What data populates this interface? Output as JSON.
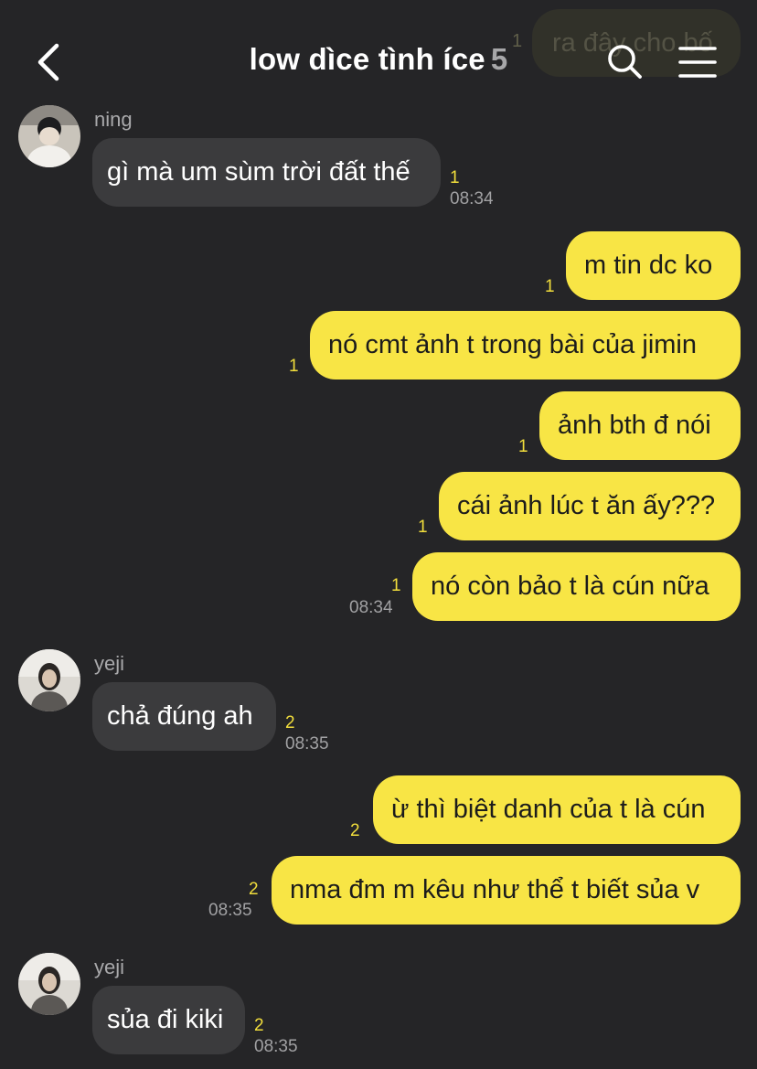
{
  "header": {
    "title": "low dìce tình íce",
    "member_count": "5",
    "back_icon": "chevron-left-icon",
    "search_icon": "search-icon",
    "menu_icon": "hamburger-menu-icon"
  },
  "ghost_message": {
    "text": "ra đây cho bố",
    "unread": "1"
  },
  "messages": [
    {
      "sender": "ning",
      "text": "gì mà um sùm trời đất thế",
      "unread": "1",
      "time": "08:34"
    },
    {
      "text": "m tin dc ko",
      "unread": "1"
    },
    {
      "text": "nó cmt ảnh t trong bài của jimin",
      "unread": "1"
    },
    {
      "text": "ảnh bth đ nói",
      "unread": "1"
    },
    {
      "text": "cái ảnh lúc t ăn ấy???",
      "unread": "1"
    },
    {
      "text": "nó còn bảo t là cún nữa",
      "unread": "1",
      "time": "08:34"
    },
    {
      "sender": "yeji",
      "text": "chả đúng ah",
      "unread": "2",
      "time": "08:35"
    },
    {
      "text": "ừ thì biệt danh của t là cún",
      "unread": "2"
    },
    {
      "text": "nma đm m kêu như thể t biết sủa v",
      "unread": "2",
      "time": "08:35"
    },
    {
      "sender": "yeji",
      "text": "sủa đi kiki",
      "unread": "2",
      "time": "08:35"
    }
  ],
  "colors": {
    "background": "#252527",
    "incoming_bubble": "#3b3b3d",
    "outgoing_bubble": "#f8e545",
    "unread_count": "#f2de3c",
    "timestamp": "#a1a1a3"
  }
}
